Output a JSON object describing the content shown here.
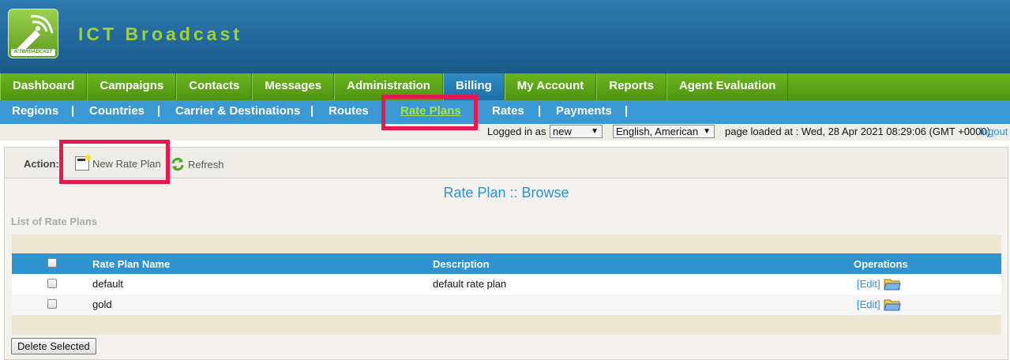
{
  "header": {
    "logo_text": "ICTBROADCAST",
    "brand": "ICT Broadcast"
  },
  "main_nav": [
    {
      "label": "Dashboard",
      "active": false
    },
    {
      "label": "Campaigns",
      "active": false
    },
    {
      "label": "Contacts",
      "active": false
    },
    {
      "label": "Messages",
      "active": false
    },
    {
      "label": "Administration",
      "active": false
    },
    {
      "label": "Billing",
      "active": true
    },
    {
      "label": "My Account",
      "active": false
    },
    {
      "label": "Reports",
      "active": false
    },
    {
      "label": "Agent Evaluation",
      "active": false
    }
  ],
  "sub_nav": [
    {
      "label": "Regions",
      "active": false
    },
    {
      "label": "Countries",
      "active": false
    },
    {
      "label": "Carrier & Destinations",
      "active": false
    },
    {
      "label": "Routes",
      "active": false
    },
    {
      "label": "Rate Plans",
      "active": true
    },
    {
      "label": "Rates",
      "active": false
    },
    {
      "label": "Payments",
      "active": false
    }
  ],
  "sub_nav_separator": "|",
  "status": {
    "logged_in_label": "Logged in as :",
    "user_value": "new",
    "language_value": "English, American",
    "page_loaded": "page loaded at : Wed, 28 Apr 2021 08:29:06 (GMT +0000)",
    "logout": "logout"
  },
  "action_bar": {
    "label": "Action:",
    "new_button": "New Rate Plan",
    "refresh_button": "Refresh"
  },
  "page_title": "Rate Plan :: Browse",
  "list_title": "List of Rate Plans",
  "table": {
    "columns": [
      "Rate Plan Name",
      "Description",
      "Operations"
    ],
    "rows": [
      {
        "name": "default",
        "description": "default rate plan",
        "edit": "[Edit]"
      },
      {
        "name": "gold",
        "description": "",
        "edit": "[Edit]"
      }
    ]
  },
  "delete_button": "Delete Selected",
  "colors": {
    "header_blue": "#21689c",
    "nav_green": "#5aa316",
    "sub_nav_blue": "#3a98d2",
    "brand_green": "#9fd136",
    "highlight_red": "#e8174f",
    "link_blue": "#2e93cf"
  }
}
